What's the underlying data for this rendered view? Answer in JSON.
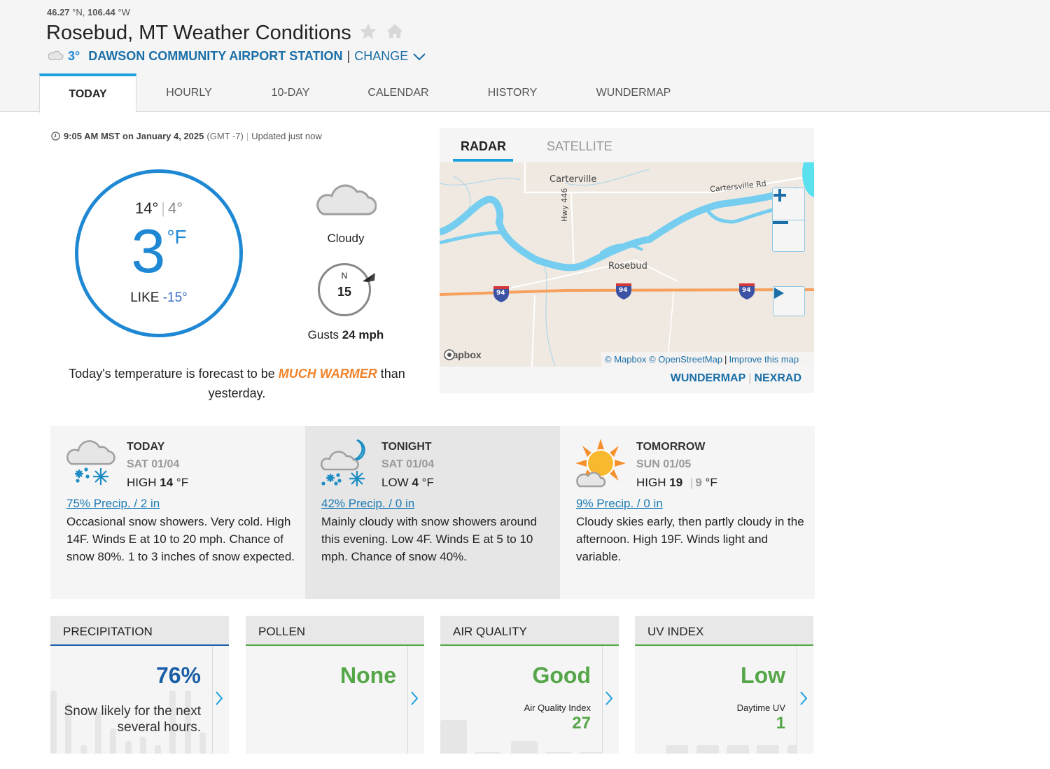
{
  "header": {
    "lat": "46.27",
    "lat_unit": "°N,",
    "lon": "106.44",
    "lon_unit": "°W",
    "title": "Rosebud, MT Weather Conditions",
    "station_icon": "cloud-icon",
    "station_temp": "3°",
    "station_name": "DAWSON COMMUNITY AIRPORT STATION",
    "separator": "|",
    "change_label": "CHANGE"
  },
  "tabs": [
    {
      "label": "TODAY",
      "active": true
    },
    {
      "label": "HOURLY",
      "active": false
    },
    {
      "label": "10-DAY",
      "active": false
    },
    {
      "label": "CALENDAR",
      "active": false
    },
    {
      "label": "HISTORY",
      "active": false
    },
    {
      "label": "WUNDERMAP",
      "active": false
    }
  ],
  "timestamp": {
    "time": "9:05 AM MST on January 4, 2025",
    "tz": "(GMT -7)",
    "sep": "|",
    "updated": "Updated just now"
  },
  "current": {
    "high": "14°",
    "low": "4°",
    "hilo_sep": "|",
    "temp": "3",
    "unit": "°F",
    "feels_label": "LIKE",
    "feels_value": "-15°",
    "condition": "Cloudy",
    "condition_icon": "cloud-icon",
    "wind_dir": "N",
    "wind_speed": "15",
    "gusts_label": "Gusts",
    "gusts_value": "24 mph"
  },
  "forecast_note": {
    "prefix": "Today's temperature is forecast to be",
    "highlight": "MUCH WARMER",
    "suffix": "than yesterday."
  },
  "map": {
    "tabs": [
      {
        "label": "RADAR",
        "active": true
      },
      {
        "label": "SATELLITE",
        "active": false
      }
    ],
    "labels": {
      "carterville": "Carterville",
      "cartersville_rd": "Cartersville Rd",
      "hwy": "Hwy 446",
      "rosebud": "Rosebud",
      "interstate": "94"
    },
    "mapbox_logo": "mapbox",
    "attribution": {
      "mapbox": "© Mapbox",
      "osm": "© OpenStreetMap",
      "sep": "|",
      "improve": "Improve this map"
    },
    "links": {
      "wundermap": "WUNDERMAP",
      "sep": "|",
      "nexrad": "NEXRAD"
    }
  },
  "forecast": [
    {
      "title": "TODAY",
      "date": "SAT 01/04",
      "temp_label": "HIGH",
      "temp": "14",
      "unit": "°F",
      "icon": "cloud-snow-icon",
      "precip": "75% Precip. / 2 in",
      "desc": "Occasional snow showers. Very cold. High 14F. Winds E at 10 to 20 mph. Chance of snow 80%. 1 to 3 inches of snow expected."
    },
    {
      "title": "TONIGHT",
      "date": "SAT 01/04",
      "temp_label": "LOW",
      "temp": "4",
      "unit": "°F",
      "icon": "night-cloud-snow-icon",
      "precip": "42% Precip. / 0 in",
      "desc": "Mainly cloudy with snow showers around this evening. Low 4F. Winds E at 5 to 10 mph. Chance of snow 40%."
    },
    {
      "title": "TOMORROW",
      "date": "SUN 01/05",
      "temp_label": "HIGH",
      "temp": "19",
      "low": "9",
      "sep": "|",
      "unit": "°F",
      "icon": "partly-cloudy-icon",
      "precip": "9% Precip. / 0 in",
      "desc": "Cloudy skies early, then partly cloudy in the afternoon. High 19F. Winds light and variable."
    }
  ],
  "modules": {
    "precipitation": {
      "title": "PRECIPITATION",
      "value": "76%",
      "text": "Snow likely for the next several hours.",
      "bars": [
        0.75,
        0.6,
        0.1,
        0.5,
        0.3,
        0.15,
        0.2,
        0.1,
        0.75,
        0.75,
        0.25
      ],
      "accent": "#1b5fa8"
    },
    "pollen": {
      "title": "POLLEN",
      "value": "None",
      "accent": "#55a648"
    },
    "air_quality": {
      "title": "AIR QUALITY",
      "value": "Good",
      "sub_label": "Air Quality Index",
      "index": "27",
      "accent": "#55a648"
    },
    "uv_index": {
      "title": "UV INDEX",
      "value": "Low",
      "sub_label": "Daytime UV",
      "index": "1",
      "accent": "#55a648"
    }
  },
  "colors": {
    "accent_blue": "#1e88d4",
    "link_blue": "#1b6fa8",
    "highlight_orange": "#f0832b",
    "good_green": "#55a648"
  }
}
